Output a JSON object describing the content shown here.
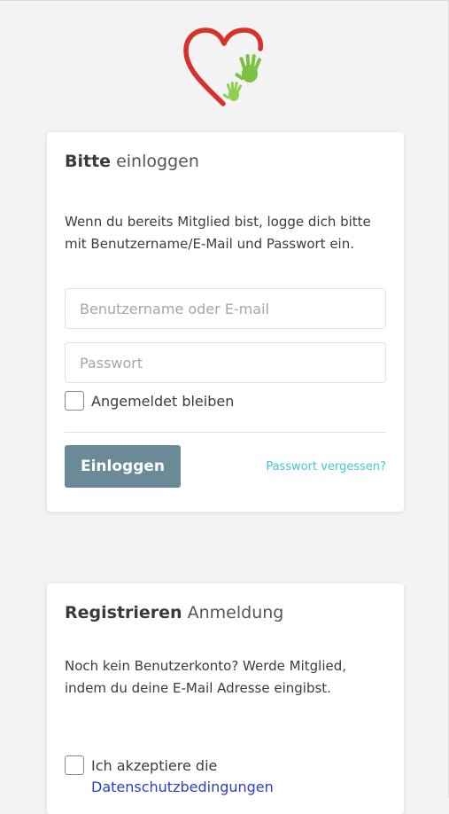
{
  "logo": {
    "icon": "heart-with-handprints-icon",
    "colors": {
      "heart": "#d6322b",
      "hands": "#7cc242"
    }
  },
  "login": {
    "title_strong": "Bitte",
    "title_light": "einloggen",
    "description": "Wenn du bereits Mitglied bist, logge dich bitte mit Benutzername/E-Mail und Passwort ein.",
    "username": {
      "value": "",
      "placeholder": "Benutzername oder E-mail"
    },
    "password": {
      "value": "",
      "placeholder": "Passwort"
    },
    "remember_label": "Angemeldet bleiben",
    "remember_checked": false,
    "submit_label": "Einloggen",
    "forgot_label": "Passwort vergessen?"
  },
  "register": {
    "title_strong": "Registrieren",
    "title_light": "Anmeldung",
    "description": "Noch kein Benutzerkonto? Werde Mitglied, indem du deine E-Mail Adresse eingibst.",
    "accept_prefix": "Ich akzeptiere die",
    "privacy_link": "Datenschutzbedingungen",
    "accept_checked": false
  },
  "colors": {
    "accent_button": "#6a8a97",
    "link_forgot": "#3fc7e0",
    "link_privacy": "#2d3ec9"
  }
}
